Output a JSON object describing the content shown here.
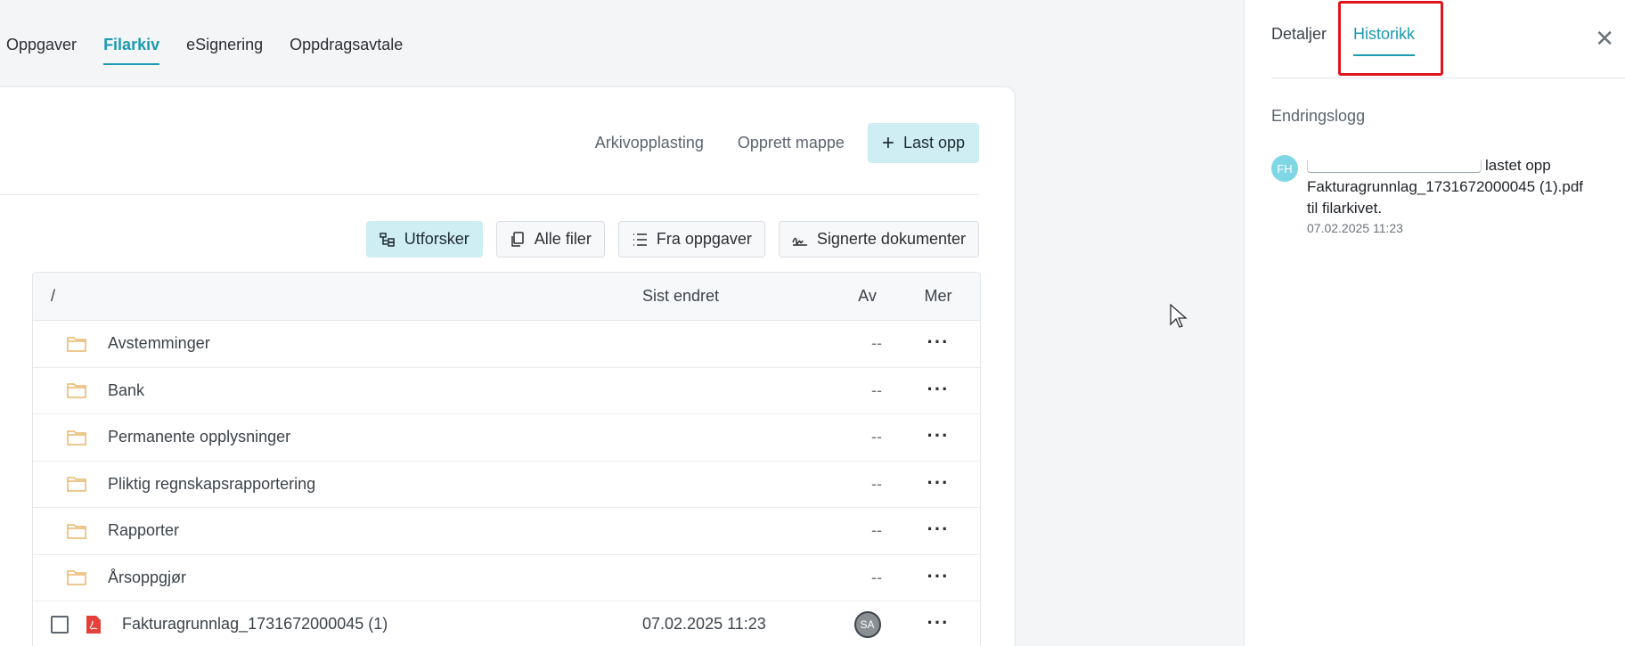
{
  "top_tabs": [
    {
      "label": "Oppgaver",
      "active": false
    },
    {
      "label": "Filarkiv",
      "active": true
    },
    {
      "label": "eSignering",
      "active": false
    },
    {
      "label": "Oppdragsavtale",
      "active": false
    }
  ],
  "toolbar": {
    "archive_upload": "Arkivopplasting",
    "create_folder": "Opprett mappe",
    "upload": "Last opp"
  },
  "views": {
    "explorer": "Utforsker",
    "all_files": "Alle filer",
    "from_tasks": "Fra oppgaver",
    "signed_docs": "Signerte dokumenter"
  },
  "table": {
    "headers": {
      "path": "/",
      "modified": "Sist endret",
      "by": "Av",
      "more": "Mer"
    },
    "folders": [
      {
        "name": "Avstemminger",
        "by": "--"
      },
      {
        "name": "Bank",
        "by": "--"
      },
      {
        "name": "Permanente opplysninger",
        "by": "--"
      },
      {
        "name": "Pliktig regnskapsrapportering",
        "by": "--"
      },
      {
        "name": "Rapporter",
        "by": "--"
      },
      {
        "name": "Årsoppgjør",
        "by": "--"
      }
    ],
    "file": {
      "name": "Fakturagrunnlag_1731672000045 (1)",
      "modified": "07.02.2025 11:23",
      "by_initials": "SA"
    }
  },
  "panel": {
    "tabs": {
      "details": "Detaljer",
      "history": "Historikk"
    },
    "log_title": "Endringslogg",
    "entry": {
      "initials": "FH",
      "action": "lastet opp",
      "filename": "Fakturagrunnlag_1731672000045 (1).pdf",
      "suffix": "til filarkivet.",
      "time": "07.02.2025 11:23"
    }
  },
  "colors": {
    "accent": "#1a9bb0",
    "primary_bg": "#cfeef4",
    "highlight": "#e0141e",
    "folder": "#e8b56a",
    "pdf": "#e5403a"
  }
}
